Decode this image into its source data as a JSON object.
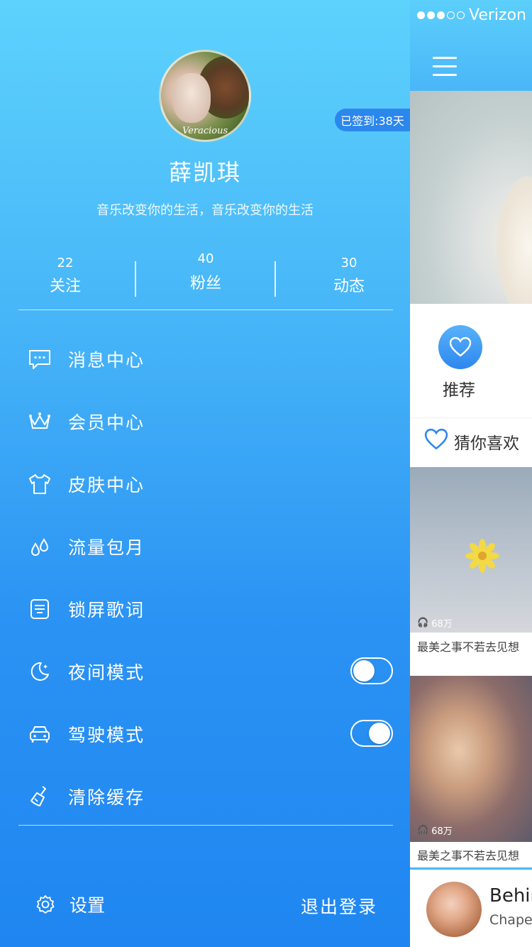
{
  "status_bar": {
    "carrier": "Verizon",
    "signal_dots_filled": 3,
    "signal_dots_total": 5
  },
  "main": {
    "recommend_label": "推荐",
    "guess_label": "猜你喜欢",
    "cards": [
      {
        "plays": "68万",
        "title": "最美之事不若去见想"
      },
      {
        "plays": "68万",
        "title": "最美之事不若去见想"
      }
    ],
    "player": {
      "song": "Behin",
      "artist": "Chapet"
    }
  },
  "drawer": {
    "avatar_caption": "Veracious",
    "checkin_badge": "已签到:38天",
    "username": "薛凯琪",
    "bio": "音乐改变你的生活，音乐改变你的生活",
    "stats": [
      {
        "value": "22",
        "label": "关注"
      },
      {
        "value": "40",
        "label": "粉丝"
      },
      {
        "value": "30",
        "label": "动态"
      }
    ],
    "menu": [
      {
        "label": "消息中心",
        "icon": "message-icon"
      },
      {
        "label": "会员中心",
        "icon": "crown-icon"
      },
      {
        "label": "皮肤中心",
        "icon": "tshirt-icon"
      },
      {
        "label": "流量包月",
        "icon": "droplets-icon"
      },
      {
        "label": "锁屏歌词",
        "icon": "lyrics-icon"
      },
      {
        "label": "夜间模式",
        "icon": "moon-icon",
        "toggle": false
      },
      {
        "label": "驾驶模式",
        "icon": "car-icon",
        "toggle": true
      },
      {
        "label": "清除缓存",
        "icon": "broom-icon"
      }
    ],
    "settings_label": "设置",
    "logout_label": "退出登录"
  },
  "colors": {
    "accent": "#2b87ec",
    "drawer_top": "#5dd2fc",
    "drawer_bottom": "#1f86f1"
  }
}
